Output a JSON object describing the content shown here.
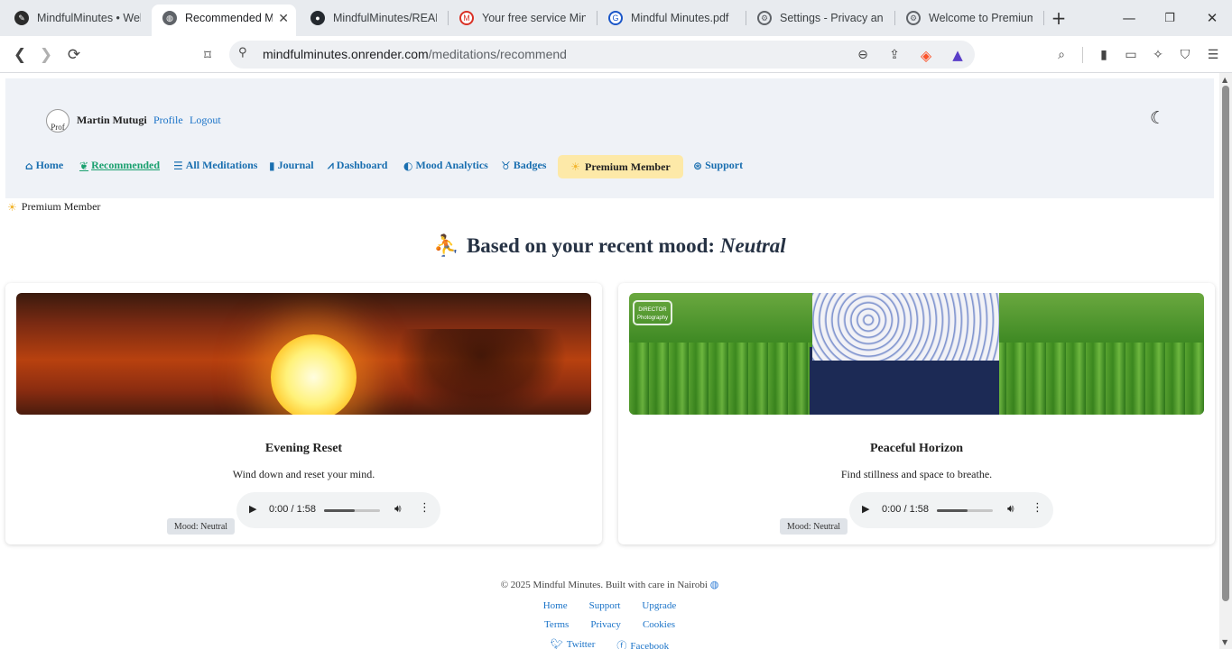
{
  "browser": {
    "tabs": [
      {
        "title": "MindfulMinutes • Wel",
        "icon": "mindfulminutes-favicon"
      },
      {
        "title": "Recommended M",
        "icon": "globe-icon",
        "active": true
      },
      {
        "title": "MindfulMinutes/READ",
        "icon": "github-icon"
      },
      {
        "title": "Your free service Minc",
        "icon": "gmail-icon"
      },
      {
        "title": "Mindful Minutes.pdf",
        "icon": "google-docs-icon"
      },
      {
        "title": "Settings - Privacy and",
        "icon": "settings-gear-icon"
      },
      {
        "title": "Welcome to Premium",
        "icon": "settings-gear-icon"
      }
    ],
    "new_tab": "+",
    "url_host": "mindfulminutes.onrender.com",
    "url_path": "/meditations/recommend"
  },
  "header": {
    "avatar_alt": "Prof",
    "username": "Martin Mutugi",
    "profile_link": "Profile",
    "logout_link": "Logout",
    "nav": [
      {
        "label": "Home",
        "icon": "home-icon"
      },
      {
        "label": "Recommended",
        "icon": "lotus-icon",
        "active": true
      },
      {
        "label": "All Meditations",
        "icon": "list-icon"
      },
      {
        "label": "Journal",
        "icon": "book-icon"
      },
      {
        "label": "Dashboard",
        "icon": "chart-line-icon"
      },
      {
        "label": "Mood Analytics",
        "icon": "brain-icon"
      },
      {
        "label": "Badges",
        "icon": "award-icon"
      },
      {
        "label": "Support",
        "icon": "support-icon"
      }
    ],
    "premium_label": "Premium Member"
  },
  "premium_line": "Premium Member",
  "heading": {
    "prefix": "Based on your recent mood:",
    "mood": "Neutral"
  },
  "cards": [
    {
      "title": "Evening Reset",
      "description": "Wind down and reset your mind.",
      "time": "0:00 / 1:58",
      "progress_fraction": 0.55,
      "badge": "Mood: Neutral"
    },
    {
      "title": "Peaceful Horizon",
      "description": "Find stillness and space to breathe.",
      "time": "0:00 / 1:58",
      "progress_fraction": 0.55,
      "badge": "Mood: Neutral",
      "image_watermark": "DIRECTOR Photography"
    }
  ],
  "footer": {
    "copyright": "© 2025 Mindful Minutes. Built with care in Nairobi",
    "links_row1": [
      "Home",
      "Support",
      "Upgrade"
    ],
    "links_row2": [
      "Terms",
      "Privacy",
      "Cookies"
    ],
    "social": [
      {
        "label": "Twitter",
        "icon": "twitter-icon"
      },
      {
        "label": "Facebook",
        "icon": "facebook-icon"
      }
    ]
  },
  "colors": {
    "nav_link": "#1a6fb0",
    "nav_active": "#1aa06f",
    "header_bg": "#eff2f7",
    "premium_pill": "#fde9a8"
  }
}
